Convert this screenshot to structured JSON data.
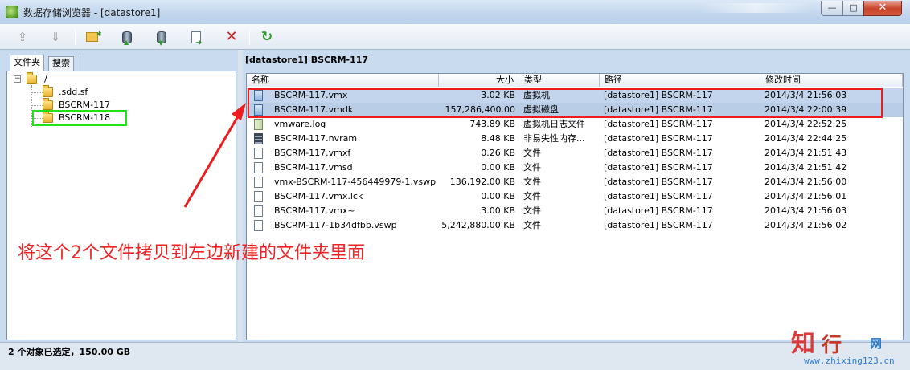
{
  "window": {
    "title": "数据存储浏览器 - [datastore1]",
    "minimize": "—",
    "maximize": "□",
    "close": "✕"
  },
  "toolbar": {
    "buttons": [
      {
        "name": "upload",
        "enabled": false
      },
      {
        "name": "download",
        "enabled": false
      },
      {
        "name": "new-folder",
        "enabled": true
      },
      {
        "name": "upload-datastore",
        "enabled": true
      },
      {
        "name": "download-datastore",
        "enabled": true
      },
      {
        "name": "register-vm",
        "enabled": true
      },
      {
        "name": "delete",
        "enabled": true
      },
      {
        "name": "refresh",
        "enabled": true
      }
    ]
  },
  "left": {
    "tabs": [
      "文件夹",
      "搜索"
    ],
    "tree": [
      {
        "label": "/",
        "expanded": true
      },
      {
        "label": ".sdd.sf"
      },
      {
        "label": "BSCRM-117"
      },
      {
        "label": "BSCRM-118"
      }
    ]
  },
  "right": {
    "header": "[datastore1] BSCRM-117",
    "columns": [
      "名称",
      "大小",
      "类型",
      "路径",
      "修改时间"
    ],
    "rows": [
      {
        "name": "BSCRM-117.vmx",
        "size": "3.02 KB",
        "type": "虚拟机",
        "path": "[datastore1] BSCRM-117",
        "modified": "2014/3/4 21:56:03",
        "icon": "vm-icon",
        "selected": true
      },
      {
        "name": "BSCRM-117.vmdk",
        "size": "157,286,400.00",
        "type": "虚拟磁盘",
        "path": "[datastore1] BSCRM-117",
        "modified": "2014/3/4 22:00:39",
        "icon": "disk-icon",
        "selected": true
      },
      {
        "name": "vmware.log",
        "size": "743.89 KB",
        "type": "虚拟机日志文件",
        "path": "[datastore1] BSCRM-117",
        "modified": "2014/3/4 22:52:25",
        "icon": "log-icon"
      },
      {
        "name": "BSCRM-117.nvram",
        "size": "8.48 KB",
        "type": "非易失性内存...",
        "path": "[datastore1] BSCRM-117",
        "modified": "2014/3/4 22:44:25",
        "icon": "nvram-icon"
      },
      {
        "name": "BSCRM-117.vmxf",
        "size": "0.26 KB",
        "type": "文件",
        "path": "[datastore1] BSCRM-117",
        "modified": "2014/3/4 21:51:43",
        "icon": "file-icon"
      },
      {
        "name": "BSCRM-117.vmsd",
        "size": "0.00 KB",
        "type": "文件",
        "path": "[datastore1] BSCRM-117",
        "modified": "2014/3/4 21:51:42",
        "icon": "file-icon"
      },
      {
        "name": "vmx-BSCRM-117-456449979-1.vswp",
        "size": "136,192.00 KB",
        "type": "文件",
        "path": "[datastore1] BSCRM-117",
        "modified": "2014/3/4 21:56:00",
        "icon": "file-icon"
      },
      {
        "name": "BSCRM-117.vmx.lck",
        "size": "0.00 KB",
        "type": "文件",
        "path": "[datastore1] BSCRM-117",
        "modified": "2014/3/4 21:56:01",
        "icon": "file-icon"
      },
      {
        "name": "BSCRM-117.vmx~",
        "size": "3.00 KB",
        "type": "文件",
        "path": "[datastore1] BSCRM-117",
        "modified": "2014/3/4 21:56:03",
        "icon": "file-icon"
      },
      {
        "name": "BSCRM-117-1b34dfbb.vswp",
        "size": "5,242,880.00 KB",
        "type": "文件",
        "path": "[datastore1] BSCRM-117",
        "modified": "2014/3/4 21:56:02",
        "icon": "file-icon"
      }
    ]
  },
  "annotation": {
    "text": "将这个2个文件拷贝到左边新建的文件夹里面",
    "color": "#ee2222",
    "highlight_green": "#22e01a",
    "highlight_red": "#ee1c1c"
  },
  "status": {
    "text": "2 个对象已选定，150.00 GB"
  },
  "watermark": {
    "zhi": "知",
    "xing": "行",
    "wang": "网",
    "url": "www.zhixing123.cn"
  }
}
